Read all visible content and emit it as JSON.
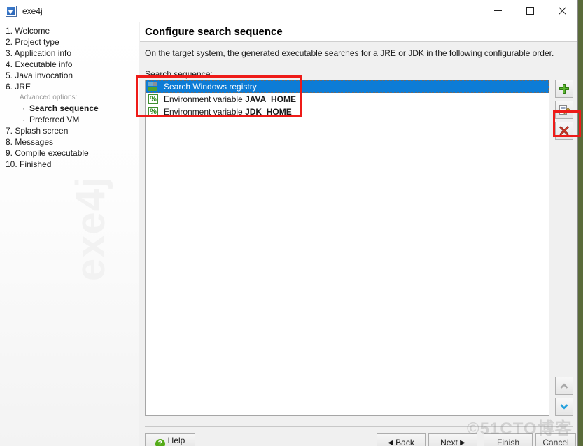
{
  "window": {
    "title": "exe4j",
    "app_icon": "exe4j-app-icon",
    "controls": {
      "minimize": "minimize-icon",
      "maximize": "maximize-icon",
      "close": "close-icon"
    }
  },
  "sidebar": {
    "watermark": "exe4j",
    "items": [
      {
        "label": "1. Welcome"
      },
      {
        "label": "2. Project type"
      },
      {
        "label": "3. Application info"
      },
      {
        "label": "4. Executable info"
      },
      {
        "label": "5. Java invocation"
      },
      {
        "label": "6. JRE"
      }
    ],
    "advanced_label": "Advanced options:",
    "sub_items": [
      {
        "bullet": "·",
        "label": "Search sequence",
        "current": true
      },
      {
        "bullet": "·",
        "label": "Preferred VM",
        "current": false
      }
    ],
    "items_after": [
      {
        "label": "7. Splash screen"
      },
      {
        "label": "8. Messages"
      },
      {
        "label": "9. Compile executable"
      },
      {
        "label": "10. Finished"
      }
    ]
  },
  "main": {
    "heading": "Configure search sequence",
    "intro": "On the target system, the generated executable searches for a JRE or JDK in the following configurable order.",
    "list_label": "Search sequence:",
    "list_rows": [
      {
        "icon": "windows-registry-icon",
        "text": "Search Windows registry",
        "strong": "",
        "selected": true
      },
      {
        "icon": "environment-variable-icon",
        "text": "Environment variable ",
        "strong": "JAVA_HOME",
        "selected": false
      },
      {
        "icon": "environment-variable-icon",
        "text": "Environment variable ",
        "strong": "JDK_HOME",
        "selected": false
      }
    ],
    "tools": {
      "add": {
        "icon": "plus-icon",
        "title": "Add"
      },
      "edit": {
        "icon": "pencil-icon",
        "title": "Edit"
      },
      "delete": {
        "icon": "delete-x-icon",
        "title": "Remove"
      },
      "move_up": {
        "icon": "chevron-up-icon",
        "title": "Move up",
        "enabled": false
      },
      "move_down": {
        "icon": "chevron-down-icon",
        "title": "Move down",
        "enabled": true
      }
    }
  },
  "footer": {
    "help": "Help",
    "back": "Back",
    "next": "Next",
    "finish": "Finish",
    "cancel": "Cancel",
    "back_arrow": "◀",
    "next_arrow": "▶",
    "help_glyph": "?",
    "watermark": "©51CTO博客"
  },
  "colors": {
    "selection_blue": "#0d7cd6",
    "annotation_red": "#ee1b18",
    "accent_green": "#4fa12e",
    "help_green": "#54ab18",
    "desktop_green": "#5a6b3a"
  }
}
